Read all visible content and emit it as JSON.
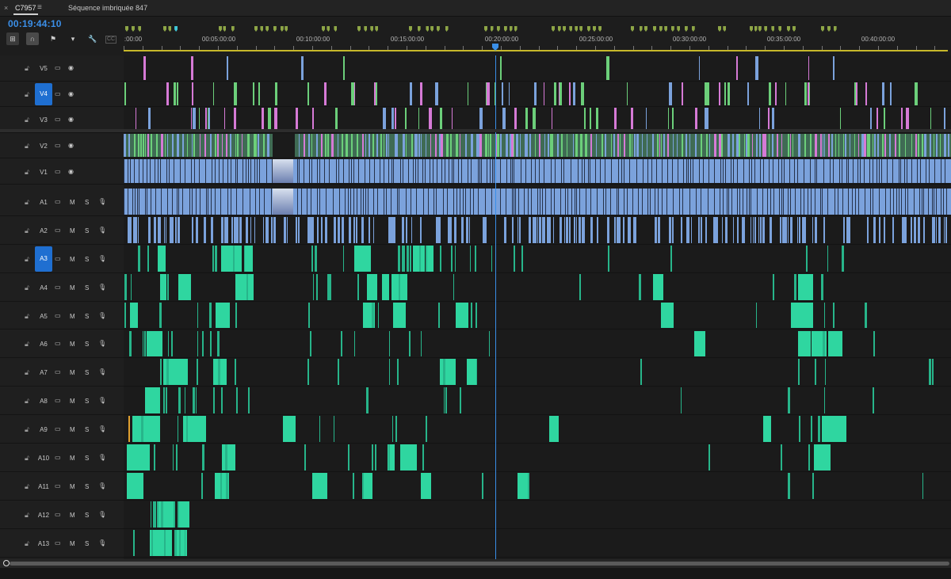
{
  "tabs": {
    "close_glyph": "×",
    "active_label": "C7957",
    "menu_glyph": "≡",
    "sequence_label": "Séquence imbriquée 847"
  },
  "timecode": "00:19:44:10",
  "tools": [
    {
      "name": "insert-tool",
      "glyph": "⊞"
    },
    {
      "name": "snap-icon",
      "glyph": "∩"
    },
    {
      "name": "linked-selection-icon",
      "glyph": "⚑"
    },
    {
      "name": "marker-icon",
      "glyph": "▾"
    },
    {
      "name": "settings-wrench-icon",
      "glyph": "🔧"
    },
    {
      "name": "captions-icon",
      "glyph": "CC"
    }
  ],
  "ruler": {
    "labels": [
      ":00:00",
      "00:05:00:00",
      "00:10:00:00",
      "00:15:00:00",
      "00:20:00:00",
      "00:25:00:00",
      "00:30:00:00",
      "00:35:00:00",
      "00:40:00:00"
    ],
    "marker_color": "#8ea646",
    "workarea_color": "#c7b82a",
    "playhead_color": "#3a8fe8"
  },
  "tracks": [
    {
      "id": "V5",
      "kind": "video",
      "selected": false
    },
    {
      "id": "V4",
      "kind": "video",
      "selected": true
    },
    {
      "id": "V3",
      "kind": "video",
      "selected": false
    },
    {
      "id": "V2",
      "kind": "video",
      "selected": false
    },
    {
      "id": "V1",
      "kind": "video",
      "selected": false
    },
    {
      "id": "A1",
      "kind": "audio",
      "selected": false
    },
    {
      "id": "A2",
      "kind": "audio",
      "selected": false
    },
    {
      "id": "A3",
      "kind": "audio",
      "selected": true
    },
    {
      "id": "A4",
      "kind": "audio",
      "selected": false
    },
    {
      "id": "A5",
      "kind": "audio",
      "selected": false
    },
    {
      "id": "A6",
      "kind": "audio",
      "selected": false
    },
    {
      "id": "A7",
      "kind": "audio",
      "selected": false
    },
    {
      "id": "A8",
      "kind": "audio",
      "selected": false
    },
    {
      "id": "A9",
      "kind": "audio",
      "selected": false
    },
    {
      "id": "A10",
      "kind": "audio",
      "selected": false
    },
    {
      "id": "A11",
      "kind": "audio",
      "selected": false
    },
    {
      "id": "A12",
      "kind": "audio",
      "selected": false
    },
    {
      "id": "A13",
      "kind": "audio",
      "selected": false
    }
  ],
  "track_buttons": {
    "mute": "M",
    "solo": "S"
  },
  "colors": {
    "video_clip": "#7ba2dc",
    "video_clip_dark": "#26324a",
    "green_clip": "#6ccf7a",
    "audio_clip": "#2fd6a0",
    "pink_clip": "#d67ad6",
    "orange_clip": "#e0a030",
    "selected_track": "#1f6fd1"
  }
}
